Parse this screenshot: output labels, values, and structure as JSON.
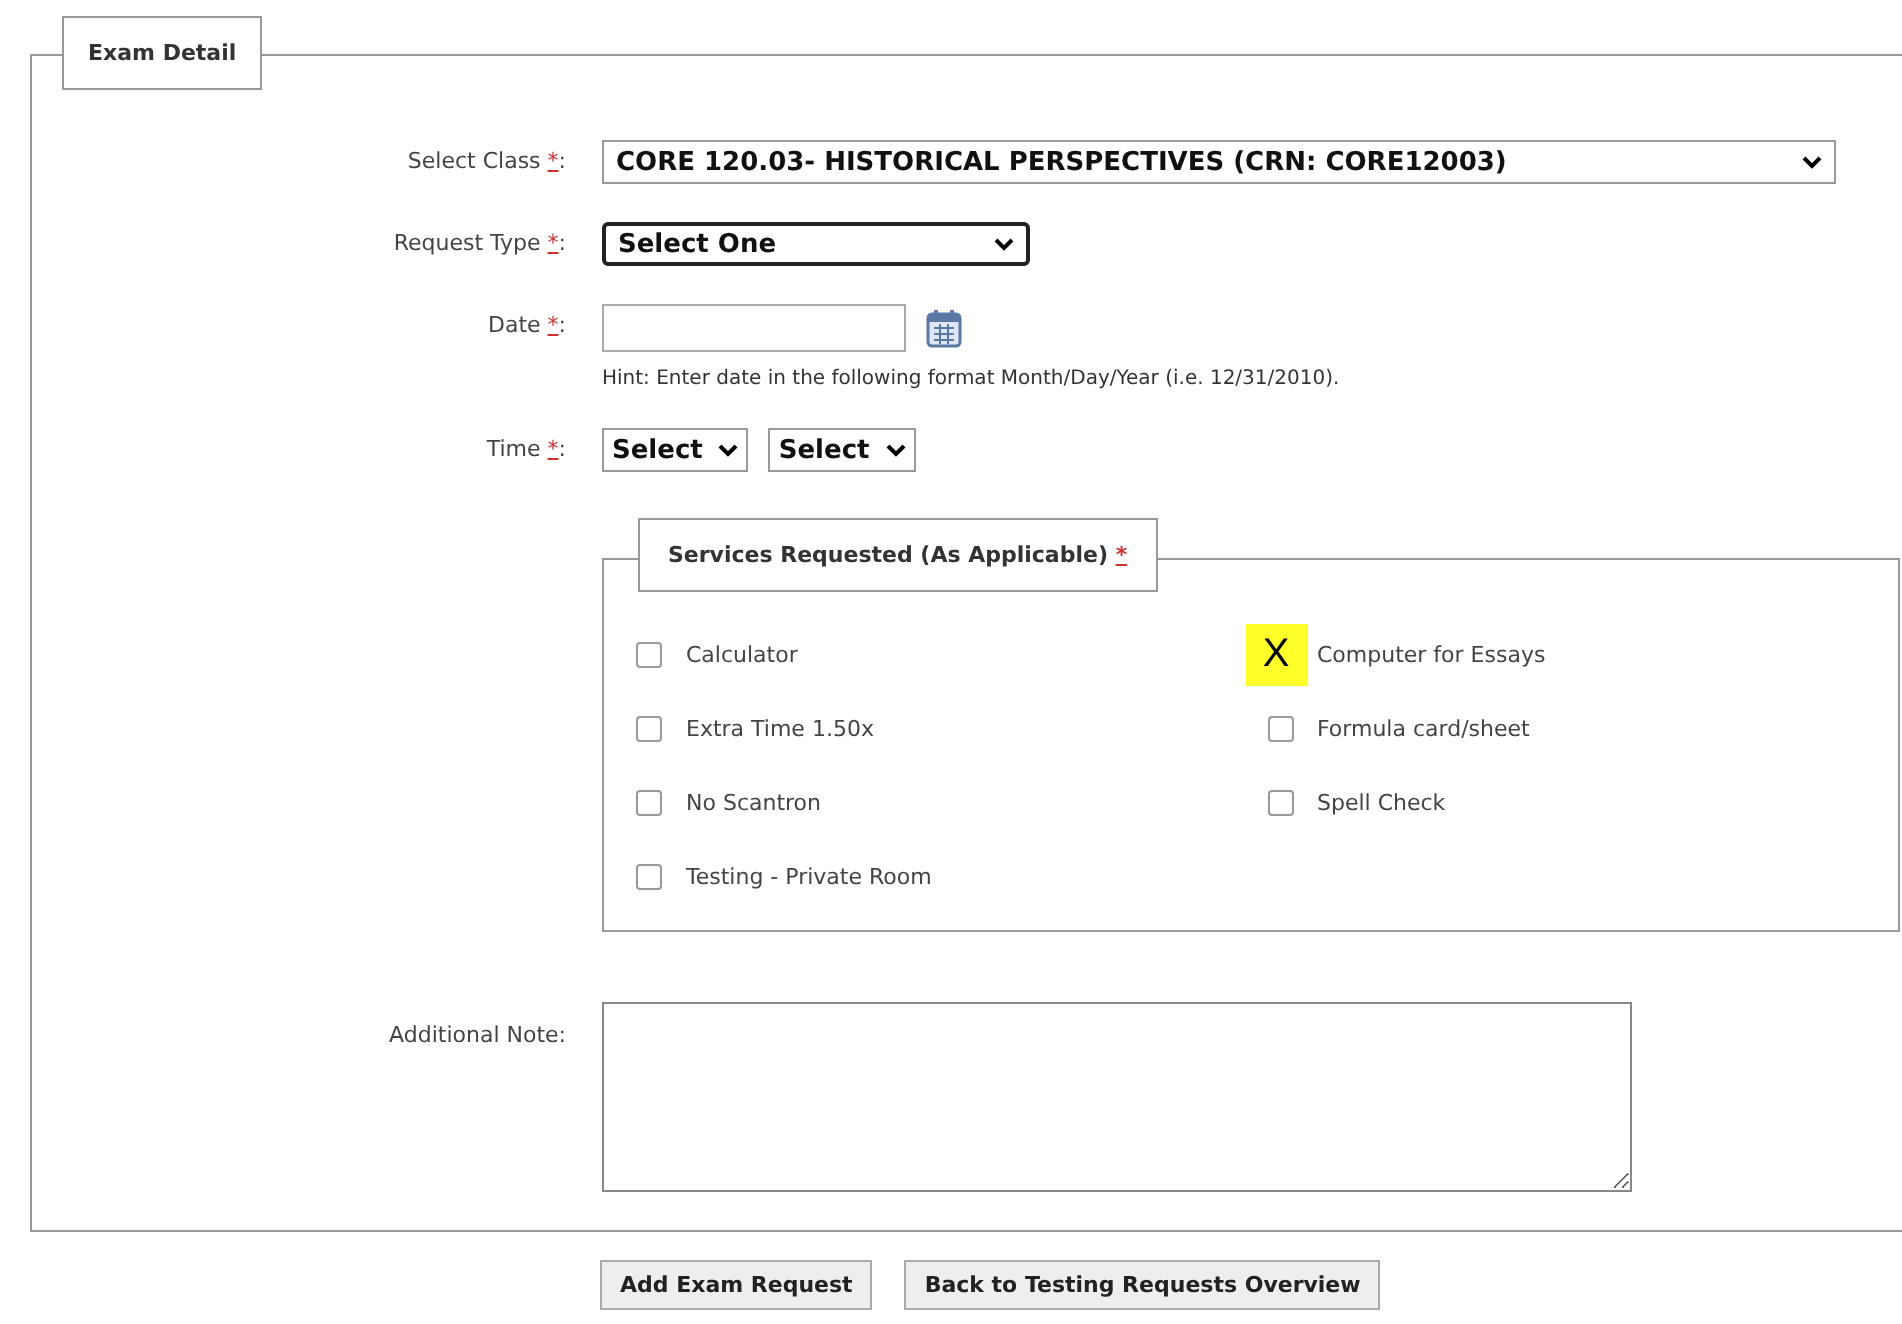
{
  "fieldset": {
    "legend": "Exam Detail"
  },
  "fields": [
    {
      "kind": "select",
      "label": "Select Class",
      "asterisk": "*",
      "suffix": ":",
      "value": "CORE 120.03- HISTORICAL PERSPECTIVES (CRN: CORE12003)",
      "focused": false
    },
    {
      "kind": "select",
      "label": "Request Type",
      "asterisk": "*",
      "suffix": ":",
      "value": "Select One",
      "focused": true
    },
    {
      "kind": "date",
      "label": "Date",
      "asterisk": "*",
      "suffix": ":",
      "hint": "Hint: Enter date in the following format Month/Day/Year (i.e. 12/31/2010)."
    },
    {
      "kind": "time",
      "label": "Time",
      "asterisk": "*",
      "suffix": ":",
      "selects": [
        "Select",
        "Select"
      ]
    }
  ],
  "services": {
    "legend": "Services Requested (As Applicable)",
    "asterisk": "*",
    "columns": [
      [
        {
          "label": "Calculator",
          "checked": false
        },
        {
          "label": "Extra Time 1.50x",
          "checked": false
        },
        {
          "label": "No Scantron",
          "checked": false
        },
        {
          "label": "Testing - Private Room",
          "checked": false
        }
      ],
      [
        {
          "label": "Computer for Essays",
          "checked": true,
          "annotation": "X"
        },
        {
          "label": "Formula card/sheet",
          "checked": false
        },
        {
          "label": "Spell Check",
          "checked": false
        }
      ]
    ]
  },
  "note": {
    "label": "Additional Note:"
  },
  "buttons": [
    "Add Exam Request",
    "Back to Testing Requests Overview"
  ]
}
